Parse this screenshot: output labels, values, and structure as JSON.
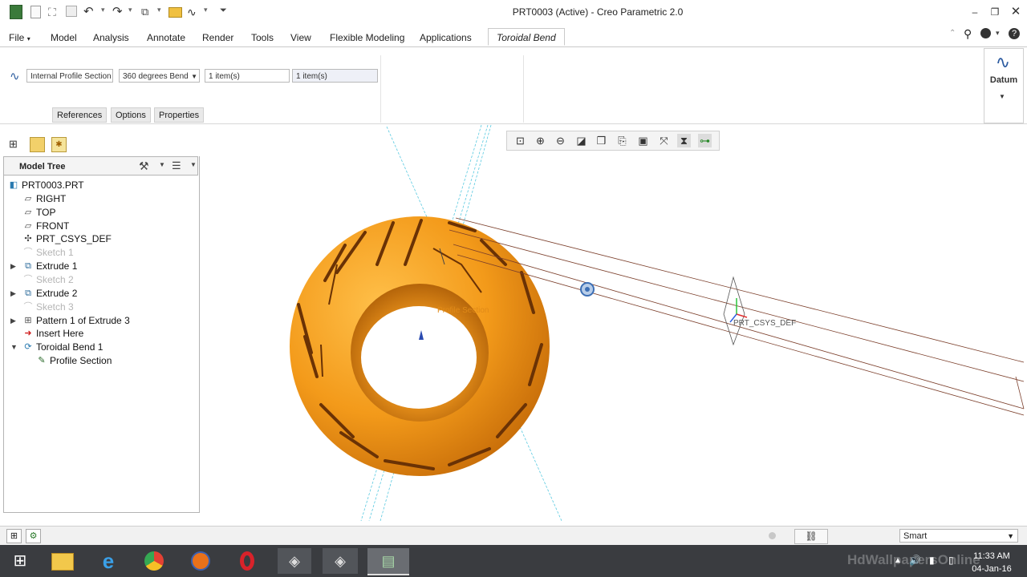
{
  "window": {
    "title": "PRT0003 (Active) - Creo Parametric 2.0"
  },
  "ribbon": {
    "tabs": [
      "File",
      "Model",
      "Analysis",
      "Annotate",
      "Render",
      "Tools",
      "View",
      "Flexible Modeling",
      "Applications",
      "Toroidal Bend"
    ],
    "active_tab": "Toroidal Bend"
  },
  "dashboard": {
    "profile_field": "Internal Profile Section",
    "bend_select": "360 degrees Bend",
    "collector_1": "1 item(s)",
    "collector_2": "1 item(s)",
    "subtabs": [
      "References",
      "Options",
      "Properties"
    ],
    "datum_label": "Datum"
  },
  "model_tree": {
    "title": "Model Tree",
    "items": [
      {
        "label": "PRT0003.PRT",
        "icon": "part-icon",
        "dim": false,
        "expand": ""
      },
      {
        "label": "RIGHT",
        "icon": "datum-plane-icon",
        "dim": false,
        "expand": ""
      },
      {
        "label": "TOP",
        "icon": "datum-plane-icon",
        "dim": false,
        "expand": ""
      },
      {
        "label": "FRONT",
        "icon": "datum-plane-icon",
        "dim": false,
        "expand": ""
      },
      {
        "label": "PRT_CSYS_DEF",
        "icon": "csys-icon",
        "dim": false,
        "expand": ""
      },
      {
        "label": "Sketch 1",
        "icon": "sketch-icon",
        "dim": true,
        "expand": ""
      },
      {
        "label": "Extrude 1",
        "icon": "extrude-icon",
        "dim": false,
        "expand": "▶"
      },
      {
        "label": "Sketch 2",
        "icon": "sketch-icon",
        "dim": true,
        "expand": ""
      },
      {
        "label": "Extrude 2",
        "icon": "extrude-icon",
        "dim": false,
        "expand": "▶"
      },
      {
        "label": "Sketch 3",
        "icon": "sketch-icon",
        "dim": true,
        "expand": ""
      },
      {
        "label": "Pattern 1 of Extrude 3",
        "icon": "pattern-icon",
        "dim": false,
        "expand": "▶"
      },
      {
        "label": "Insert Here",
        "icon": "insert-arrow-icon",
        "dim": false,
        "expand": ""
      },
      {
        "label": "Toroidal Bend 1",
        "icon": "toroidal-bend-icon",
        "dim": false,
        "expand": "▼"
      },
      {
        "label": "Profile Section",
        "icon": "profile-section-icon",
        "dim": false,
        "expand": ""
      }
    ]
  },
  "graphics": {
    "annotation_profile": "Profile Section",
    "annotation_csys": "PRT_CSYS_DEF",
    "colors": {
      "tire": "#f39a1a",
      "tire_dark": "#8a4a0c",
      "datum_line": "#58c9e0",
      "edge_line": "#7b3e2a"
    }
  },
  "status_bar": {
    "filter": "Smart"
  },
  "taskbar": {
    "time": "11:33 AM",
    "date": "04-Jan-16",
    "watermark": "HdWallpapersOnline"
  }
}
